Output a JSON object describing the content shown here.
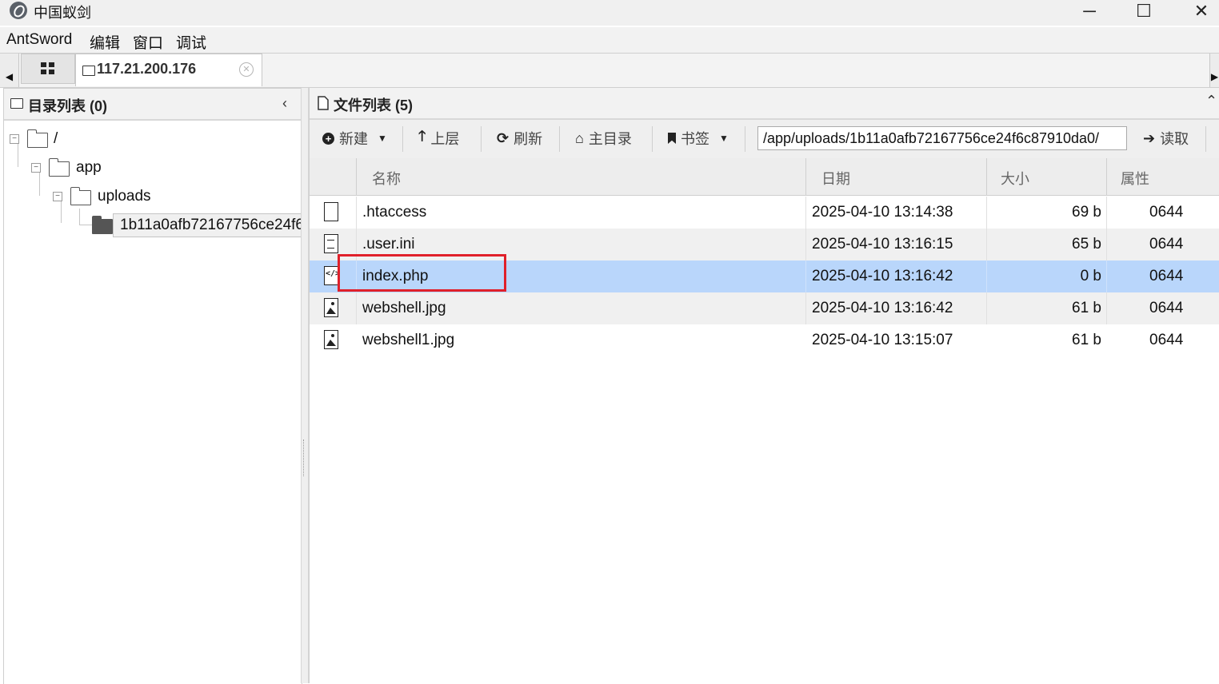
{
  "window": {
    "title": "中国蚁剑",
    "controls": {
      "minimize": "─",
      "maximize": "☐",
      "close": "✕"
    }
  },
  "menu": [
    "AntSword",
    "编辑",
    "窗口",
    "调试"
  ],
  "tabs": {
    "active_label": "117.21.200.176"
  },
  "directory_panel": {
    "title": "目录列表 (0)",
    "tree": [
      {
        "label": "/"
      },
      {
        "label": "app"
      },
      {
        "label": "uploads"
      },
      {
        "label": "1b11a0afb72167756ce24f6"
      }
    ]
  },
  "file_panel": {
    "title": "文件列表 (5)",
    "toolbar": {
      "new": "新建",
      "up": "上层",
      "refresh": "刷新",
      "home": "主目录",
      "bookmarks": "书签",
      "path": "/app/uploads/1b11a0afb72167756ce24f6c87910da0/",
      "read": "读取"
    },
    "columns": {
      "name": "名称",
      "date": "日期",
      "size": "大小",
      "attr": "属性"
    },
    "files": [
      {
        "name": ".htaccess",
        "date": "2025-04-10 13:14:38",
        "size": "69 b",
        "attr": "0644",
        "icon": "file-icon"
      },
      {
        "name": ".user.ini",
        "date": "2025-04-10 13:16:15",
        "size": "65 b",
        "attr": "0644",
        "icon": "text-file-icon"
      },
      {
        "name": "index.php",
        "date": "2025-04-10 13:16:42",
        "size": "0 b",
        "attr": "0644",
        "icon": "code-file-icon",
        "selected": true
      },
      {
        "name": "webshell.jpg",
        "date": "2025-04-10 13:16:42",
        "size": "61 b",
        "attr": "0644",
        "icon": "image-file-icon"
      },
      {
        "name": "webshell1.jpg",
        "date": "2025-04-10 13:15:07",
        "size": "61 b",
        "attr": "0644",
        "icon": "image-file-icon"
      }
    ]
  },
  "colors": {
    "selection": "#b9d6fb",
    "highlight_box": "#e0202a"
  }
}
